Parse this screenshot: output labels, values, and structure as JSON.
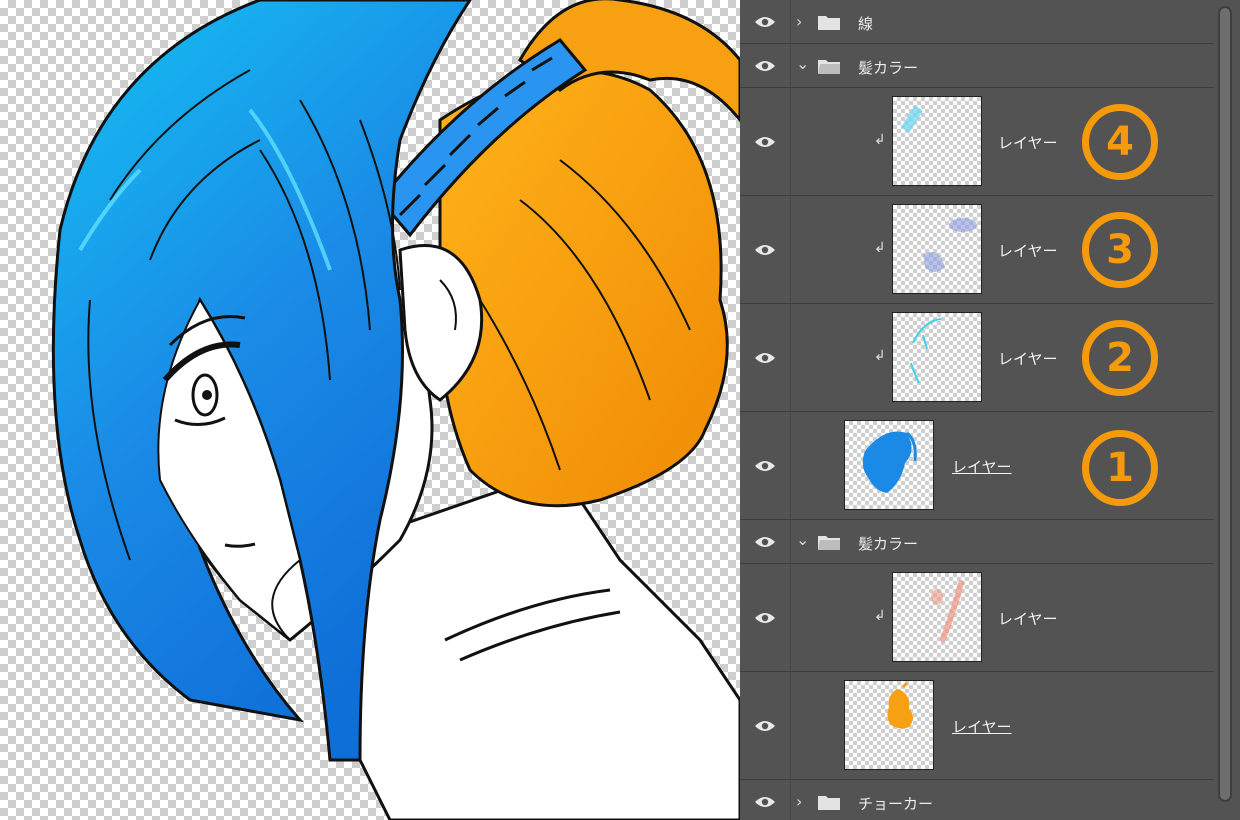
{
  "layers": {
    "groups": {
      "line": {
        "name": "線",
        "expanded": false
      },
      "hair_color_1": {
        "name": "髪カラー",
        "expanded": true
      },
      "hair_color_2": {
        "name": "髪カラー",
        "expanded": true
      },
      "choker": {
        "name": "チョーカー",
        "expanded": false
      }
    },
    "items": [
      {
        "name": "レイヤー",
        "clipped": true,
        "badge": "4"
      },
      {
        "name": "レイヤー",
        "clipped": true,
        "badge": "3"
      },
      {
        "name": "レイヤー",
        "clipped": true,
        "badge": "2"
      },
      {
        "name": "レイヤー",
        "clipped": false,
        "badge": "1"
      },
      {
        "name": "レイヤー",
        "clipped": true
      },
      {
        "name": "レイヤー",
        "clipped": false
      }
    ],
    "clip_symbol": "↲"
  },
  "colors": {
    "panel_bg": "#535353",
    "hair_blue": "#1a8ae6",
    "hair_orange": "#f7a012",
    "badge_orange": "#f59a0c"
  },
  "icons": {
    "visibility": "eye-icon",
    "collapsed": "chevron-right-icon",
    "expanded": "chevron-down-icon",
    "group": "folder-icon",
    "clip": "clipping-mask-icon"
  }
}
